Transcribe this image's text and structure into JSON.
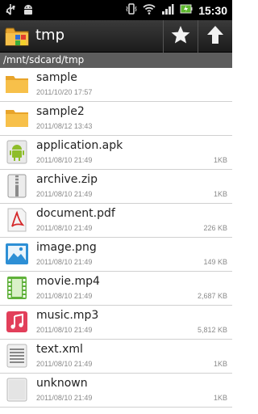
{
  "status_bar": {
    "time": "15:30",
    "icons": [
      "usb-icon",
      "android-debug-icon",
      "vibrate-icon",
      "wifi-icon",
      "signal-icon",
      "battery-icon"
    ]
  },
  "action_bar": {
    "title": "tmp",
    "buttons": [
      "star-icon",
      "up-arrow-icon"
    ]
  },
  "path": "/mnt/sdcard/tmp",
  "files": [
    {
      "name": "sample",
      "date": "2011/10/20  17:57",
      "size": "",
      "icon": "folder-icon"
    },
    {
      "name": "sample2",
      "date": "2011/08/12  13:43",
      "size": "",
      "icon": "folder-icon"
    },
    {
      "name": "application.apk",
      "date": "2011/08/10  21:49",
      "size": "1KB",
      "icon": "android-icon"
    },
    {
      "name": "archive.zip",
      "date": "2011/08/10  21:49",
      "size": "1KB",
      "icon": "zip-icon"
    },
    {
      "name": "document.pdf",
      "date": "2011/08/10  21:49",
      "size": "226 KB",
      "icon": "pdf-icon"
    },
    {
      "name": "image.png",
      "date": "2011/08/10  21:49",
      "size": "149 KB",
      "icon": "image-icon"
    },
    {
      "name": "movie.mp4",
      "date": "2011/08/10  21:49",
      "size": "2,687 KB",
      "icon": "video-icon"
    },
    {
      "name": "music.mp3",
      "date": "2011/08/10  21:49",
      "size": "5,812 KB",
      "icon": "music-icon"
    },
    {
      "name": "text.xml",
      "date": "2011/08/10  21:49",
      "size": "1KB",
      "icon": "text-icon"
    },
    {
      "name": "unknown",
      "date": "2011/08/10  21:49",
      "size": "1KB",
      "icon": "unknown-file-icon"
    }
  ]
}
